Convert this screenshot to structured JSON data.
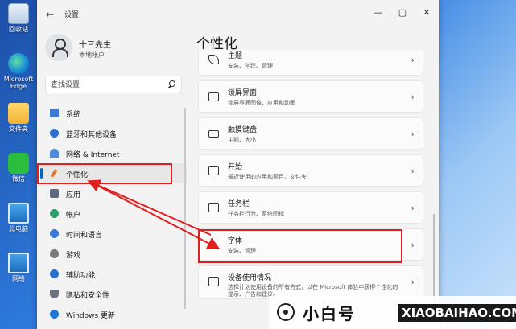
{
  "desktop": {
    "icons": [
      {
        "label": "回收站",
        "icon": "recycle-bin-icon"
      },
      {
        "label": "Microsoft Edge",
        "icon": "edge-icon"
      },
      {
        "label": "文件夹",
        "icon": "folder-icon"
      },
      {
        "label": "微信",
        "icon": "wechat-icon"
      },
      {
        "label": "此电脑",
        "icon": "computer-icon"
      },
      {
        "label": "网络",
        "icon": "network-icon"
      }
    ]
  },
  "window": {
    "title": "设置",
    "back_glyph": "←",
    "controls": {
      "minimize": "—",
      "maximize": "▢",
      "close": "✕"
    }
  },
  "profile": {
    "name": "十三先生",
    "account_type": "本地帐户"
  },
  "search": {
    "placeholder": "查找设置"
  },
  "nav": {
    "items": [
      {
        "label": "系统",
        "color": "#3a7bd5"
      },
      {
        "label": "蓝牙和其他设备",
        "color": "#2a6fcf"
      },
      {
        "label": "网络 & Internet",
        "color": "#4a8ad8"
      },
      {
        "label": "个性化",
        "color": "#e07a2f"
      },
      {
        "label": "应用",
        "color": "#5a6b80"
      },
      {
        "label": "帐户",
        "color": "#2f9d6a"
      },
      {
        "label": "时间和语言",
        "color": "#3a7bd5"
      },
      {
        "label": "游戏",
        "color": "#7a7a7a"
      },
      {
        "label": "辅助功能",
        "color": "#2a6fcf"
      },
      {
        "label": "隐私和安全性",
        "color": "#6c7380"
      },
      {
        "label": "Windows 更新",
        "color": "#1f75d1"
      }
    ],
    "active_index": 3
  },
  "main": {
    "title": "个性化",
    "cards": [
      {
        "title": "主题",
        "subtitle": "安装、创建、管理",
        "icon": "theme-icon"
      },
      {
        "title": "锁屏界面",
        "subtitle": "锁屏界面图像、应用和动画",
        "icon": "lock-screen-icon"
      },
      {
        "title": "触摸键盘",
        "subtitle": "主题、大小",
        "icon": "keyboard-icon"
      },
      {
        "title": "开始",
        "subtitle": "最近使用的应用和项目、文件夹",
        "icon": "start-icon"
      },
      {
        "title": "任务栏",
        "subtitle": "任务栏行为、系统图标",
        "icon": "taskbar-icon"
      },
      {
        "title": "字体",
        "subtitle": "安装、管理",
        "icon": "font-icon"
      },
      {
        "title": "设备使用情况",
        "subtitle": "选择计划使用设备的所有方式，以在 Microsoft 体验中获得个性化的提示、广告和建议。",
        "icon": "device-usage-icon"
      }
    ],
    "chevron": "›"
  },
  "watermark": {
    "brand": "小白号",
    "domain": "XIAOBAIHAO.COM"
  },
  "annotation_color": "#e02020"
}
